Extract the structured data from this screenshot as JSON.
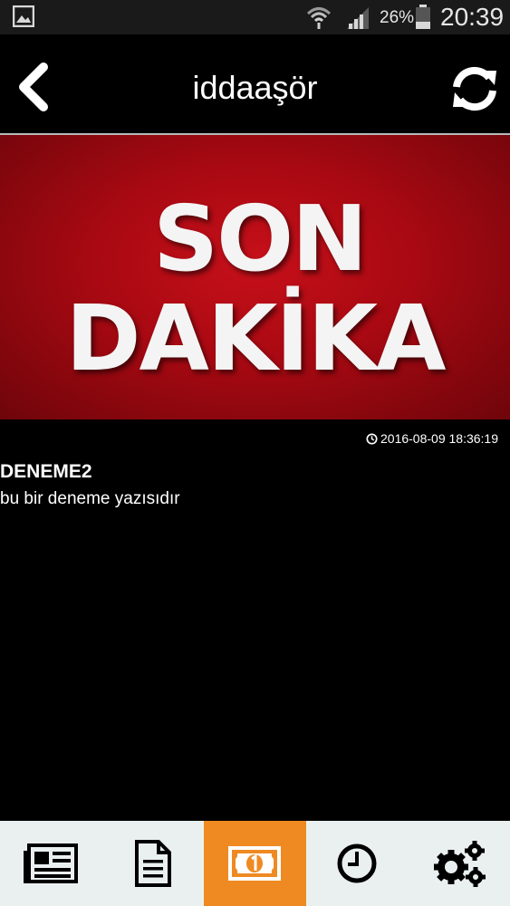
{
  "status_bar": {
    "battery_percent": "26%",
    "time": "20:39",
    "icons": [
      "gallery-icon",
      "wifi-icon",
      "signal-icon",
      "battery-icon"
    ]
  },
  "header": {
    "title": "iddaaşör",
    "back_icon": "chevron-left-icon",
    "refresh_icon": "refresh-icon"
  },
  "banner": {
    "line1": "SON",
    "line2": "DAKİKA",
    "color": "#c7101a"
  },
  "article": {
    "timestamp": "2016-08-09 18:36:19",
    "title": "DENEME2",
    "body": "bu bir deneme yazısıdır"
  },
  "bottom_nav": {
    "active_index": 2,
    "active_color": "#ef8a22",
    "items": [
      {
        "icon": "newspaper-icon"
      },
      {
        "icon": "document-icon"
      },
      {
        "icon": "money-icon"
      },
      {
        "icon": "clock-icon"
      },
      {
        "icon": "settings-gears-icon"
      }
    ]
  }
}
